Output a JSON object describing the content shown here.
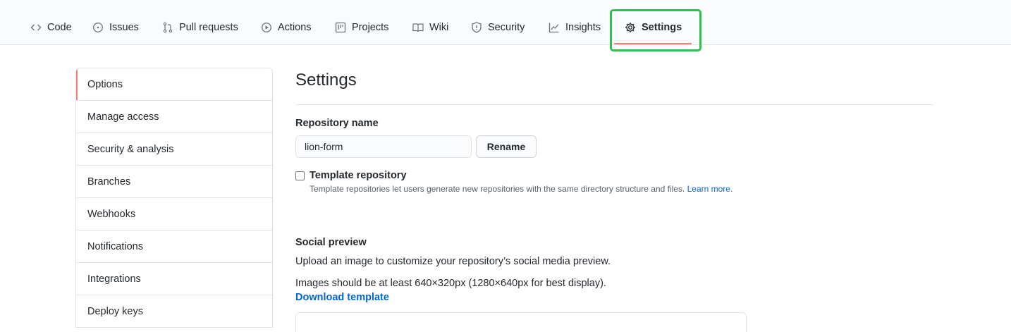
{
  "tabs": [
    {
      "label": "Code",
      "icon": "code-icon"
    },
    {
      "label": "Issues",
      "icon": "issue-icon"
    },
    {
      "label": "Pull requests",
      "icon": "pull-request-icon"
    },
    {
      "label": "Actions",
      "icon": "play-icon"
    },
    {
      "label": "Projects",
      "icon": "project-icon"
    },
    {
      "label": "Wiki",
      "icon": "book-icon"
    },
    {
      "label": "Security",
      "icon": "shield-icon"
    },
    {
      "label": "Insights",
      "icon": "graph-icon"
    },
    {
      "label": "Settings",
      "icon": "gear-icon",
      "active": true
    }
  ],
  "sidebar": {
    "items": [
      {
        "label": "Options",
        "selected": true
      },
      {
        "label": "Manage access"
      },
      {
        "label": "Security & analysis"
      },
      {
        "label": "Branches"
      },
      {
        "label": "Webhooks"
      },
      {
        "label": "Notifications"
      },
      {
        "label": "Integrations"
      },
      {
        "label": "Deploy keys"
      }
    ]
  },
  "main": {
    "title": "Settings",
    "repo_name_label": "Repository name",
    "repo_name_value": "lion-form",
    "rename_label": "Rename",
    "template_label": "Template repository",
    "template_help": "Template repositories let users generate new repositories with the same directory structure and files.",
    "template_learn_more": "Learn more.",
    "social_title": "Social preview",
    "social_desc": "Upload an image to customize your repository’s social media preview.",
    "social_size": "Images should be at least 640×320px (1280×640px for best display).",
    "download_template": "Download template"
  },
  "colors": {
    "accent_underline": "#f9826c",
    "highlight_box": "#2dc24a",
    "link": "#0366d6"
  }
}
